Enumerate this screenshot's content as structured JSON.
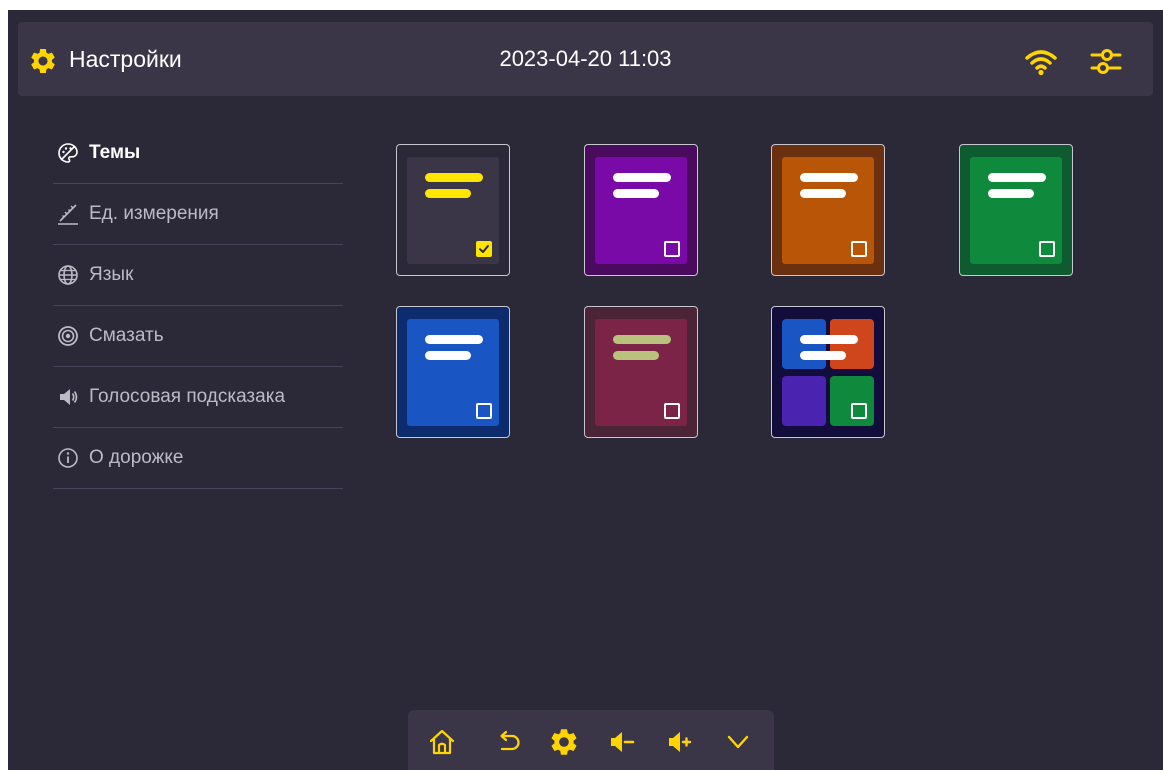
{
  "header": {
    "title": "Настройки",
    "datetime": "2023-04-20 11:03",
    "icons": {
      "settings": "gear-icon",
      "wifi": "wifi-icon",
      "options": "tune-icon"
    }
  },
  "menu": {
    "items": [
      {
        "label": "Темы",
        "icon": "palette-icon",
        "active": true
      },
      {
        "label": "Ед. измерения",
        "icon": "ruler-icon",
        "active": false
      },
      {
        "label": "Язык",
        "icon": "globe-icon",
        "active": false
      },
      {
        "label": "Смазать",
        "icon": "target-icon",
        "active": false
      },
      {
        "label": "Голосовая подсказака",
        "icon": "speaker-icon",
        "active": false
      },
      {
        "label": "О дорожке",
        "icon": "info-icon",
        "active": false
      }
    ]
  },
  "themes": [
    {
      "name": "dark-yellow",
      "outer": "#2b2838",
      "inner": "#3a3648",
      "bars": "#ffe600",
      "selected": true
    },
    {
      "name": "purple",
      "outer": "#4a0a5e",
      "inner": "#7a0aa8",
      "bars": "#ffffff",
      "selected": false
    },
    {
      "name": "orange",
      "outer": "#6b3010",
      "inner": "#b85506",
      "bars": "#ffffff",
      "selected": false
    },
    {
      "name": "green",
      "outer": "#0d5b2e",
      "inner": "#0f8a3c",
      "bars": "#ffffff",
      "selected": false
    },
    {
      "name": "blue",
      "outer": "#0d2c6e",
      "inner": "#1a55c4",
      "bars": "#ffffff",
      "selected": false
    },
    {
      "name": "crimson",
      "outer": "#4b2435",
      "inner": "#7b2447",
      "bars": "#b9c27c",
      "selected": false
    },
    {
      "name": "multicolor",
      "outer": "#130d3c",
      "inner": "",
      "bars": "#ffffff",
      "selected": false,
      "quads": [
        "#1a55c4",
        "#d0461c",
        "#4a23b0",
        "#0f8a3c"
      ]
    }
  ],
  "bottom_bar": {
    "buttons": [
      "home-icon",
      "back-icon",
      "settings-icon",
      "volume-down-icon",
      "volume-up-icon",
      "chevron-down-icon"
    ]
  },
  "colors": {
    "accent": "#ffd400",
    "background": "#2b2838",
    "panel": "#3a3648"
  }
}
